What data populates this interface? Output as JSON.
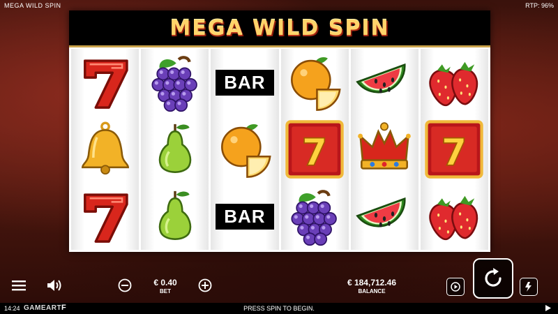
{
  "top": {
    "title": "MEGA WILD SPIN",
    "rtp": "RTP: 96%"
  },
  "banner": {
    "title": "MEGA WILD SPIN"
  },
  "reels": [
    [
      "seven",
      "bell",
      "seven"
    ],
    [
      "grapes",
      "pear",
      "pear"
    ],
    [
      "bar",
      "orange",
      "bar"
    ],
    [
      "orange",
      "seven-framed",
      "grapes"
    ],
    [
      "watermelon",
      "crown",
      "watermelon"
    ],
    [
      "strawberry",
      "seven-framed",
      "strawberry"
    ]
  ],
  "symbols": {
    "bar": "BAR",
    "seven": "7"
  },
  "controls": {
    "bet_value": "€ 0.40",
    "bet_label": "BET",
    "balance_value": "€ 184,712.46",
    "balance_label": "BALANCE"
  },
  "footer": {
    "time": "14:24",
    "brand": "GAMEART",
    "brand_mark": "F",
    "message": "PRESS SPIN TO BEGIN."
  },
  "colors": {
    "banner_text": "#ffd46a",
    "background": "#5a1d12",
    "seven_red": "#d8261c"
  }
}
